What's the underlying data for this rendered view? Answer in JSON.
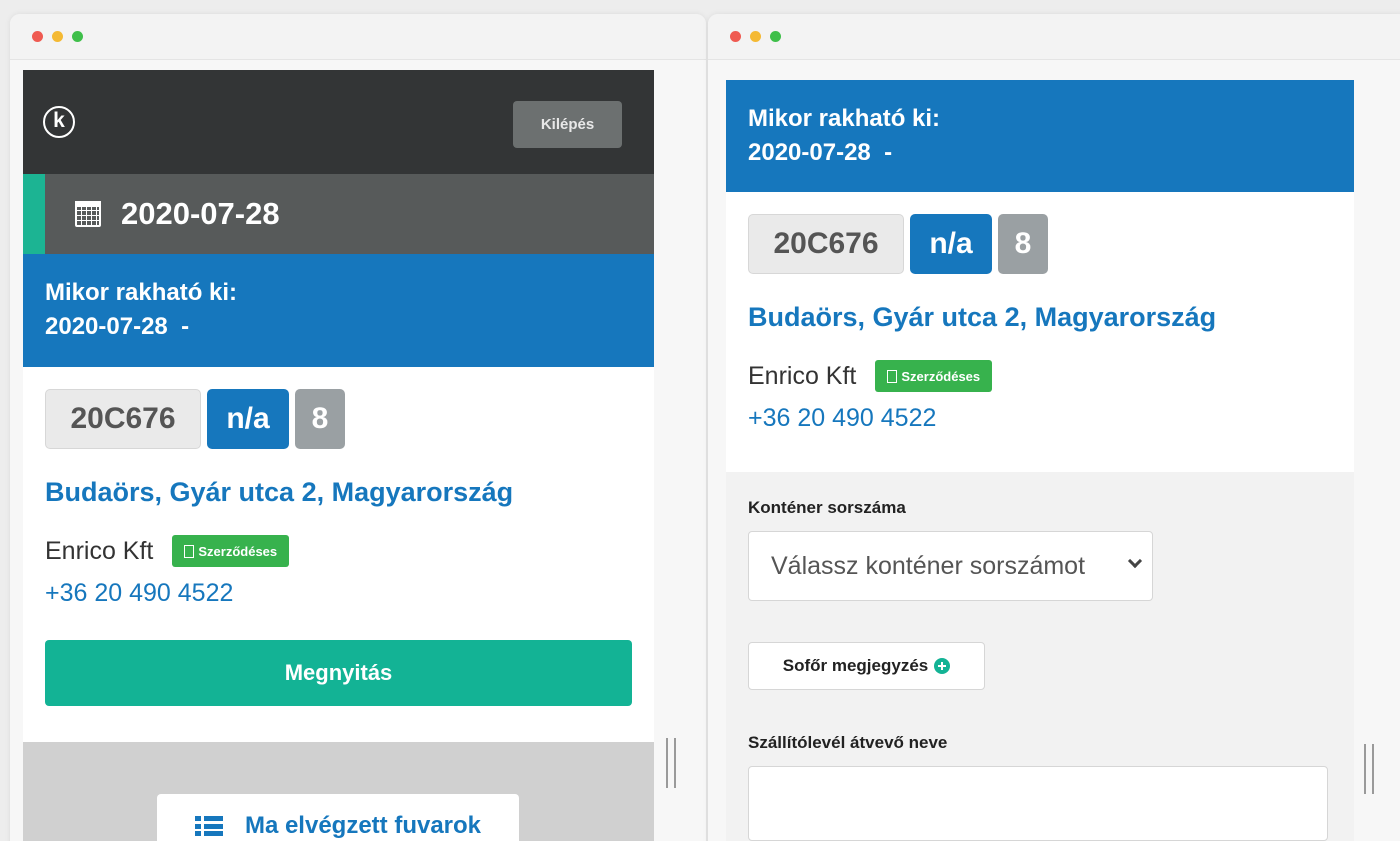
{
  "left_app": {
    "header": {
      "logo_letter": "k",
      "logout_label": "Kilépés"
    },
    "date_bar": {
      "date": "2020-07-28"
    },
    "unload": {
      "title": "Mikor rakható ki:",
      "date_range": "2020-07-28  -"
    },
    "job": {
      "container_id": "20C676",
      "status": "n/a",
      "count": "8",
      "address": "Budaörs, Gyár utca 2, Magyarország",
      "company": "Enrico Kft",
      "contract_badge": "Szerződéses",
      "phone": "+36 20 490 4522"
    },
    "open_button": "Megnyitás",
    "completed_jobs_button": "Ma elvégzett fuvarok"
  },
  "right_app": {
    "unload": {
      "title": "Mikor rakható ki:",
      "date_range": "2020-07-28  -"
    },
    "job": {
      "container_id": "20C676",
      "status": "n/a",
      "count": "8",
      "address": "Budaörs, Gyár utca 2, Magyarország",
      "company": "Enrico Kft",
      "contract_badge": "Szerződéses",
      "phone": "+36 20 490 4522"
    },
    "form": {
      "container_number_label": "Konténer sorszáma",
      "container_number_placeholder": "Válassz konténer sorszámot",
      "driver_note_button": "Sofőr megjegyzés",
      "receiver_name_label": "Szállítólevél átvevő neve",
      "receiver_name_value": ""
    }
  },
  "colors": {
    "brand_blue": "#1677bd",
    "accent_green": "#13b395",
    "badge_green": "#37b24d",
    "dark_header": "#333536"
  }
}
